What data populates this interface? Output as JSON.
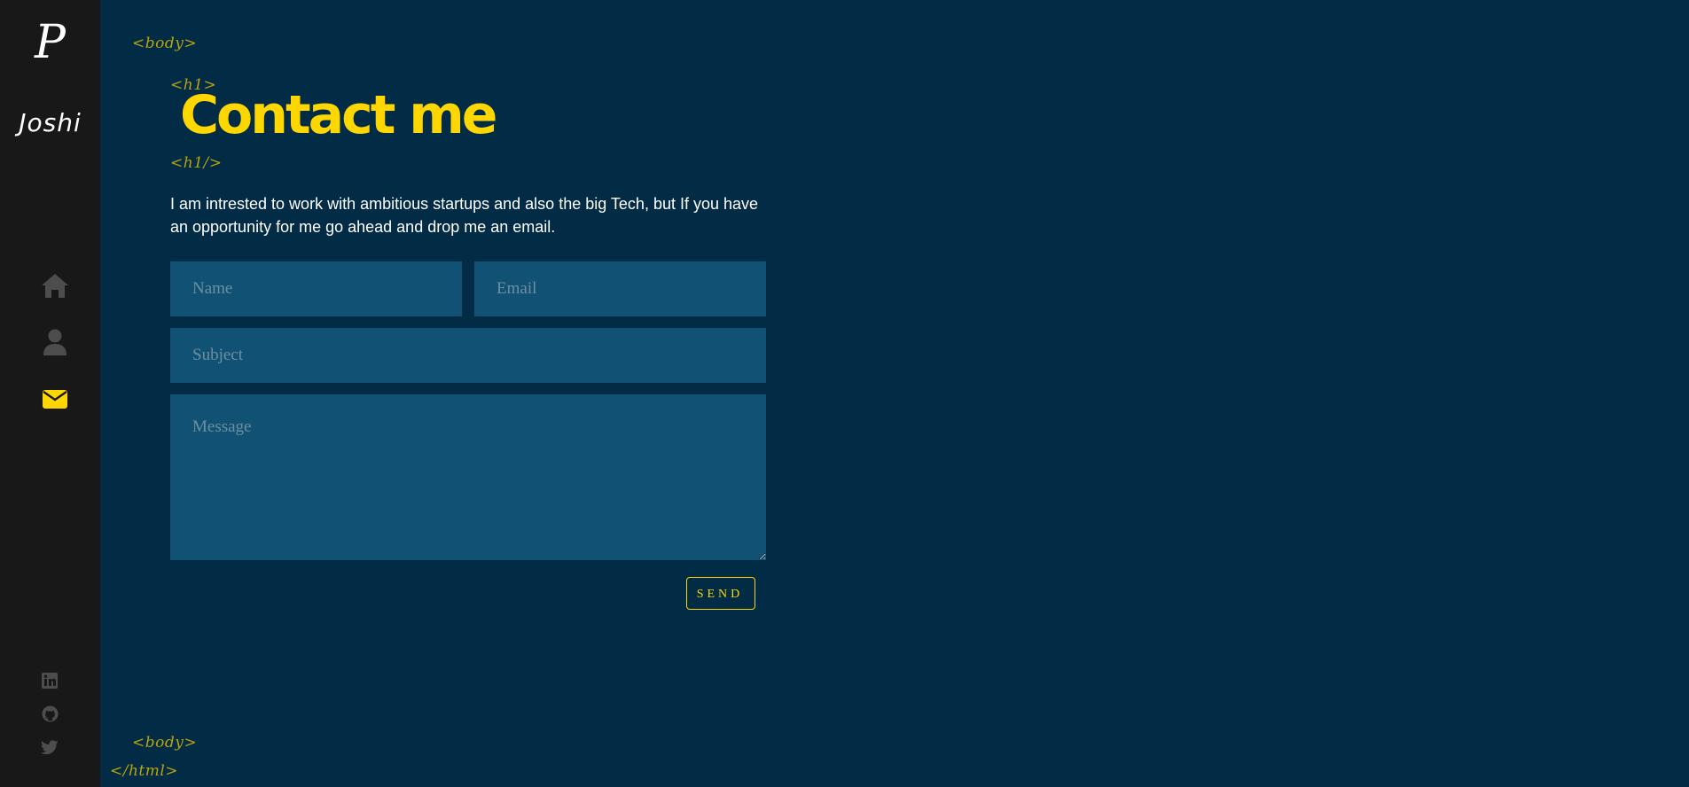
{
  "sidebar": {
    "logo_letter": "P",
    "logo_name": "Joshi",
    "nav": [
      {
        "icon": "home-icon",
        "active": false
      },
      {
        "icon": "user-icon",
        "active": false
      },
      {
        "icon": "envelope-icon",
        "active": true
      }
    ],
    "social": [
      {
        "icon": "linkedin-icon"
      },
      {
        "icon": "github-icon"
      },
      {
        "icon": "twitter-icon"
      }
    ]
  },
  "tags": {
    "body_open": "<body>",
    "h1_open": "<h1>",
    "h1_close": "<h1/>",
    "body_close": "<body>",
    "html_close": "</html>"
  },
  "contact": {
    "title": "Contact me",
    "intro": "I am intrested to work with ambitious startups and also the big Tech, but If you have an opportunity for me go ahead and drop me an email.",
    "form": {
      "name_placeholder": "Name",
      "email_placeholder": "Email",
      "subject_placeholder": "Subject",
      "message_placeholder": "Message",
      "send_label": "SEND"
    }
  },
  "colors": {
    "background": "#022b45",
    "sidebar": "#181818",
    "accent": "#ffd700",
    "field_bg": "#115274",
    "tag": "#b9a30f",
    "icon_inactive": "#4d4d4e"
  }
}
